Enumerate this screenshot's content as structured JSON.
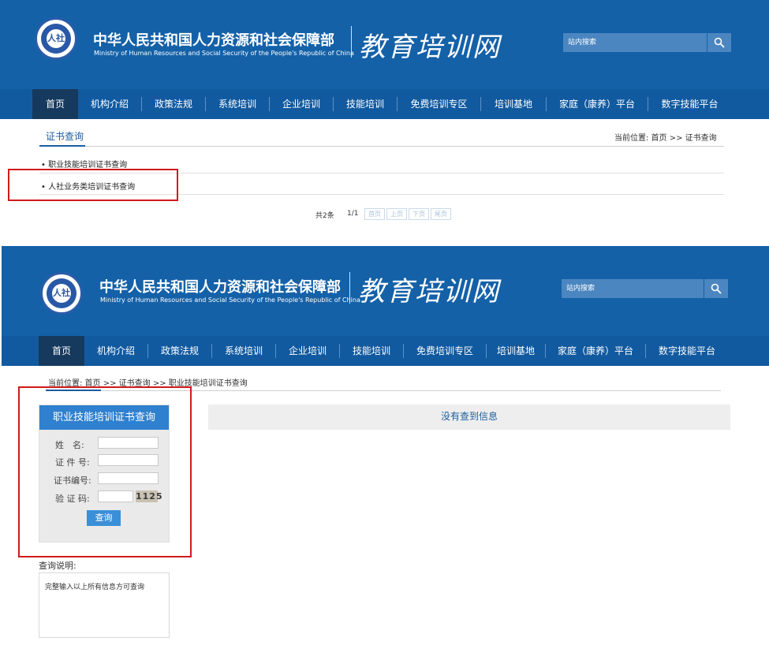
{
  "header": {
    "emblem_text": "人力资源社会保障部",
    "title_cn": "中华人民共和国人力资源和社会保障部",
    "title_en": "Ministry of Human Resources and Social Security of the People's Republic of China",
    "site_name": "教育培训网",
    "search_placeholder": "站内搜索",
    "icons": {
      "emblem": "ministry-emblem-icon",
      "search": "search-icon"
    }
  },
  "nav": {
    "items": [
      "首页",
      "机构介绍",
      "政策法规",
      "系统培训",
      "企业培训",
      "技能培训",
      "免费培训专区",
      "培训基地",
      "家庭（康养）平台",
      "数字技能平台"
    ],
    "active_index": 0
  },
  "page1": {
    "tab_title": "证书查询",
    "breadcrumb": "当前位置: 首页 >> 证书查询",
    "links": [
      "职业技能培训证书查询",
      "人社业务类培训证书查询"
    ],
    "pagination": {
      "total": "共2条",
      "page": "1/1",
      "buttons": [
        "首页",
        "上页",
        "下页",
        "尾页"
      ]
    }
  },
  "page2": {
    "breadcrumb": "当前位置: 首页 >> 证书查询 >> 职业技能培训证书查询",
    "form": {
      "title": "职业技能培训证书查询",
      "labels": [
        "姓　名:",
        "证 件 号:",
        "证书编号:",
        "验 证 码:"
      ],
      "captcha": "1125",
      "submit_label": "查询"
    },
    "result_text": "没有查到信息",
    "notes_title": "查询说明:",
    "notes_text": "完整输入以上所有信息方可查询"
  },
  "colors": {
    "header_blue": "#1461a8",
    "nav_active": "#163a5e",
    "highlight_red": "#d11a1a",
    "form_head_blue": "#2f80cf"
  }
}
